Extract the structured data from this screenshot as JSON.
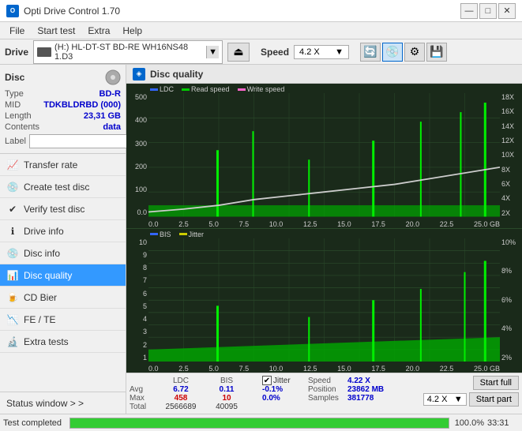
{
  "app": {
    "title": "Opti Drive Control 1.70",
    "icon": "O"
  },
  "titlebar": {
    "minimize": "—",
    "maximize": "□",
    "close": "✕"
  },
  "menu": {
    "items": [
      "File",
      "Start test",
      "Extra",
      "Help"
    ]
  },
  "drive": {
    "label": "Drive",
    "name": "(H:)  HL-DT-ST BD-RE  WH16NS48 1.D3",
    "speed_label": "Speed",
    "speed_value": "4.2 X"
  },
  "disc": {
    "title": "Disc",
    "type_label": "Type",
    "type_value": "BD-R",
    "mid_label": "MID",
    "mid_value": "TDKBLDRBD (000)",
    "length_label": "Length",
    "length_value": "23,31 GB",
    "contents_label": "Contents",
    "contents_value": "data",
    "label_label": "Label"
  },
  "nav": {
    "items": [
      {
        "id": "transfer-rate",
        "label": "Transfer rate",
        "icon": "📈"
      },
      {
        "id": "create-test-disc",
        "label": "Create test disc",
        "icon": "💿"
      },
      {
        "id": "verify-test-disc",
        "label": "Verify test disc",
        "icon": "✔"
      },
      {
        "id": "drive-info",
        "label": "Drive info",
        "icon": "ℹ"
      },
      {
        "id": "disc-info",
        "label": "Disc info",
        "icon": "💿"
      },
      {
        "id": "disc-quality",
        "label": "Disc quality",
        "icon": "📊",
        "active": true
      },
      {
        "id": "cd-bier",
        "label": "CD Bier",
        "icon": "🍺"
      },
      {
        "id": "fe-te",
        "label": "FE / TE",
        "icon": "📉"
      },
      {
        "id": "extra-tests",
        "label": "Extra tests",
        "icon": "🔬"
      }
    ],
    "status_window": "Status window > >"
  },
  "content": {
    "title": "Disc quality",
    "icon": "◈",
    "chart1": {
      "legend": [
        {
          "label": "LDC",
          "color": "#3366ff"
        },
        {
          "label": "Read speed",
          "color": "#00cc00"
        },
        {
          "label": "Write speed",
          "color": "#ff66cc"
        }
      ],
      "y_left": [
        "500",
        "400",
        "300",
        "200",
        "100",
        "0.0"
      ],
      "y_right": [
        "18X",
        "16X",
        "14X",
        "12X",
        "10X",
        "8X",
        "6X",
        "4X",
        "2X"
      ],
      "x_labels": [
        "0.0",
        "2.5",
        "5.0",
        "7.5",
        "10.0",
        "12.5",
        "15.0",
        "17.5",
        "20.0",
        "22.5",
        "25.0 GB"
      ]
    },
    "chart2": {
      "legend": [
        {
          "label": "BIS",
          "color": "#3366ff"
        },
        {
          "label": "Jitter",
          "color": "#cccc00"
        }
      ],
      "y_left": [
        "10",
        "9",
        "8",
        "7",
        "6",
        "5",
        "4",
        "3",
        "2",
        "1"
      ],
      "y_right": [
        "10%",
        "8%",
        "6%",
        "4%",
        "2%"
      ],
      "x_labels": [
        "0.0",
        "2.5",
        "5.0",
        "7.5",
        "10.0",
        "12.5",
        "15.0",
        "17.5",
        "20.0",
        "22.5",
        "25.0 GB"
      ]
    },
    "stats": {
      "headers": [
        "",
        "LDC",
        "BIS",
        "",
        "Jitter",
        "Speed",
        ""
      ],
      "avg_label": "Avg",
      "avg_ldc": "6.72",
      "avg_bis": "0.11",
      "avg_jitter": "-0.1%",
      "max_label": "Max",
      "max_ldc": "458",
      "max_bis": "10",
      "max_jitter": "0.0%",
      "total_label": "Total",
      "total_ldc": "2566689",
      "total_bis": "40095",
      "jitter_label": "Jitter",
      "speed_label": "Speed",
      "speed_value": "4.22 X",
      "position_label": "Position",
      "position_value": "23862 MB",
      "samples_label": "Samples",
      "samples_value": "381778",
      "start_full": "Start full",
      "start_part": "Start part",
      "speed_select": "4.2 X"
    }
  },
  "bottom": {
    "status": "Test completed",
    "progress": "100.0%",
    "time": "33:31"
  }
}
